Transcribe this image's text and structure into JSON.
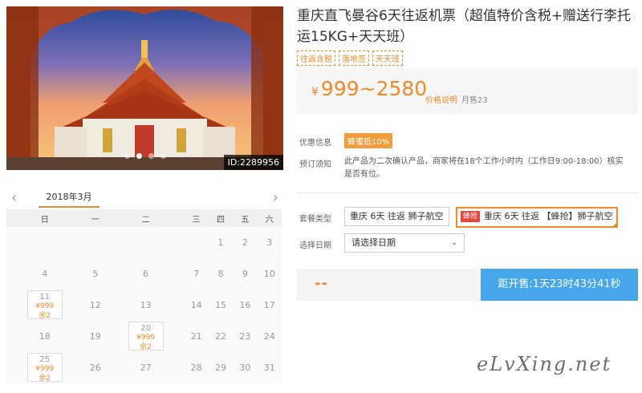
{
  "hero": {
    "id_label": "ID:2289956"
  },
  "product": {
    "title": "重庆直飞曼谷6天往返机票（超值特价含税+赠送行李托运15KG+天天班）",
    "tags": [
      "往返含税",
      "落地签",
      "天天班"
    ],
    "price_symbol": "¥",
    "price": "999~2580",
    "price_note": "价格说明",
    "sold": "月售23"
  },
  "info": {
    "promo_label": "优惠信息",
    "promo_badge": "蜂蜜抵10%",
    "notice_label": "预订须知",
    "notice_text": "此产品为二次确认产品，商家将在18个工作小时内（工作日9:00-18:00）核实是否有位。"
  },
  "options": {
    "package_label": "套餐类型",
    "packages": [
      "重庆 6天 往返 狮子航空",
      "重庆 6天 往返 【蜂抢】狮子航空"
    ],
    "flash_badge": "蜂抢",
    "package_2_text": "重庆 6天 往返 【蜂抢】狮子航空",
    "date_label": "选择日期",
    "date_placeholder": "请选择日期"
  },
  "booking": {
    "price_placeholder": "--",
    "countdown": "距开售:1天23时43分41秒"
  },
  "calendar": {
    "month": "2018年3月",
    "weekdays": [
      "日",
      "一",
      "二",
      "三",
      "四",
      "五",
      "六"
    ],
    "cells": {
      "r1": [
        "",
        "",
        "",
        "",
        "1",
        "2",
        "3"
      ],
      "r2": [
        "4",
        "5",
        "6",
        "7",
        "8",
        "9",
        "10"
      ],
      "r3": [
        "",
        "12",
        "13",
        "14",
        "15",
        "16",
        "17"
      ],
      "r4": [
        "18",
        "19",
        "",
        "21",
        "22",
        "23",
        "24"
      ],
      "r5": [
        "",
        "26",
        "27",
        "28",
        "29",
        "30",
        "31"
      ]
    },
    "priced": {
      "d11": {
        "day": "11",
        "price": "¥999",
        "remain": "余2"
      },
      "d20": {
        "day": "20",
        "price": "¥999",
        "remain": "余2"
      },
      "d25": {
        "day": "25",
        "price": "¥999",
        "remain": "余2"
      }
    }
  },
  "watermark": "eLvXing.net",
  "colors": {
    "accent": "#f08a2c",
    "countdown_bg": "#45a6ea",
    "flash_red": "#e8463f"
  }
}
